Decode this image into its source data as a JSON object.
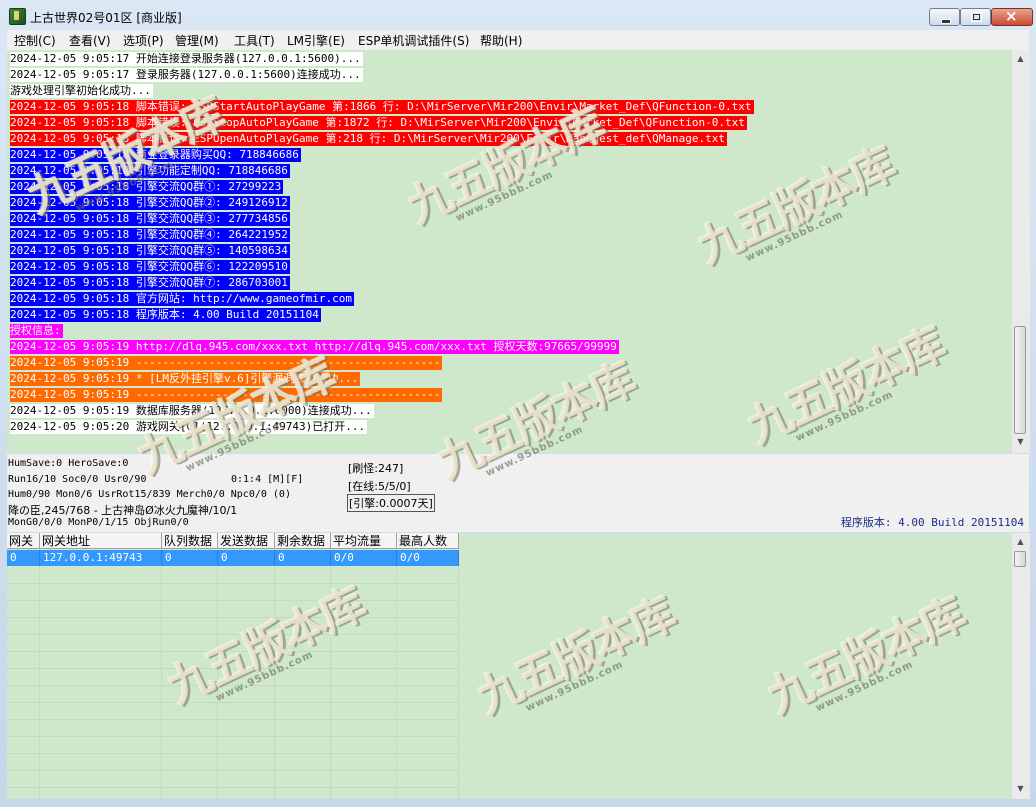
{
  "window": {
    "title": "上古世界02号01区 [商业版]"
  },
  "menu": [
    "控制(C)",
    "查看(V)",
    "选项(P)",
    "管理(M)",
    "工具(T)",
    "LM引擎(E)",
    "ESP单机调试插件(S)",
    "帮助(H)"
  ],
  "colors": {
    "red": "#ff0000",
    "blue": "#0000ff",
    "magenta": "#ff00ff",
    "orange": "#ff6a00",
    "white": "#ffffff",
    "log_bg": "#cfe8cc",
    "selection": "#3399ff"
  },
  "log_lines": [
    {
      "text": "2024-12-05 9:05:17 开始连接登录服务器(127.0.0.1:5600)...",
      "style": "white"
    },
    {
      "text": "2024-12-05 9:05:17 登录服务器(127.0.0.1:5600)连接成功...",
      "style": "white"
    },
    {
      "text": "游戏处理引擎初始化成功...",
      "style": "white"
    },
    {
      "text": "2024-12-05 9:05:18 脚本错误: ESPStartAutoPlayGame 第:1866 行: D:\\MirServer\\Mir200\\Envir\\Market_Def\\QFunction-0.txt",
      "style": "red"
    },
    {
      "text": "2024-12-05 9:05:18 脚本错误: ESPStopAutoPlayGame 第:1872 行: D:\\MirServer\\Mir200\\Envir\\Market_Def\\QFunction-0.txt",
      "style": "red"
    },
    {
      "text": "2024-12-05 9:05:18 脚本错误: ESPOpenAutoPlayGame 第:218 行: D:\\MirServer\\Mir200\\Envir\\MapQuest_def\\QManage.txt",
      "style": "red"
    },
    {
      "text": "2024-12-05 9:05:18 商业登录器购买QQ: 718846686",
      "style": "blue"
    },
    {
      "text": "2024-12-05 9:05:18 引擎功能定制QQ: 718846686",
      "style": "blue"
    },
    {
      "text": "2024-12-05 9:05:18 引擎交流QQ群①: 27299223",
      "style": "blue"
    },
    {
      "text": "2024-12-05 9:05:18 引擎交流QQ群②: 249126912",
      "style": "blue"
    },
    {
      "text": "2024-12-05 9:05:18 引擎交流QQ群③: 277734856",
      "style": "blue"
    },
    {
      "text": "2024-12-05 9:05:18 引擎交流QQ群④: 264221952",
      "style": "blue"
    },
    {
      "text": "2024-12-05 9:05:18 引擎交流QQ群⑤: 140598634",
      "style": "blue"
    },
    {
      "text": "2024-12-05 9:05:18 引擎交流QQ群⑥: 122209510",
      "style": "blue"
    },
    {
      "text": "2024-12-05 9:05:18 引擎交流QQ群⑦: 286703001",
      "style": "blue"
    },
    {
      "text": "2024-12-05 9:05:18 官方网站: http://www.gameofmir.com",
      "style": "blue"
    },
    {
      "text": "2024-12-05 9:05:18 程序版本: 4.00 Build 20151104",
      "style": "blue"
    },
    {
      "text": "授权信息:",
      "style": "magenta"
    },
    {
      "text": "2024-12-05 9:05:19 http://dlq.945.com/xxx.txt http://dlq.945.com/xxx.txt 授权天数:97665/99999",
      "style": "magenta"
    },
    {
      "text": "2024-12-05 9:05:19 ----------------------------------------------",
      "style": "orange"
    },
    {
      "text": "2024-12-05 9:05:19 * [LM反外挂引擎v.6]引擎漏洞修复成功...",
      "style": "orange"
    },
    {
      "text": "2024-12-05 9:05:19 ----------------------------------------------",
      "style": "orange"
    },
    {
      "text": "2024-12-05 9:05:19 数据库服务器(127.0.0.1:6000)连接成功...",
      "style": "white"
    },
    {
      "text": "2024-12-05 9:05:20 游戏网关[0](127.0.0.1:49743)已打开...",
      "style": "white"
    }
  ],
  "status": {
    "line1": "HumSave:0 HeroSave:0",
    "line2": "Run16/10 Soc0/0 Usr0/90",
    "line2_right": "0:1:4 [M][F]",
    "line3": "Hum0/90 Mon0/6 UsrRot15/839 Merch0/0 Npc0/0 (0)",
    "line4": "降の臣,245/768 - 上古神岛Ø冰火九魔神/10/1",
    "line5": "MonG0/0/0 MonP0/1/15 ObjRun0/0",
    "mob": "[刷怪:247]",
    "online": "[在线:5/5/0]",
    "engine": "[引擎:0.0007天]",
    "version": "程序版本: 4.00 Build 20151104"
  },
  "gateway_table": {
    "headers": [
      "网关",
      "网关地址",
      "队列数据",
      "发送数据",
      "剩余数据",
      "平均流量",
      "最高人数"
    ],
    "rows": [
      [
        "0",
        "127.0.0.1:49743",
        "0",
        "0",
        "0",
        "0/0",
        "0/0"
      ]
    ]
  },
  "watermark": {
    "main": "九五版本库",
    "sub": "www.95bbb.com"
  }
}
